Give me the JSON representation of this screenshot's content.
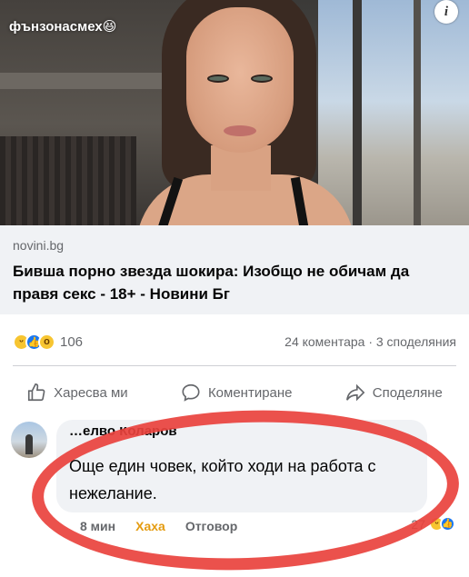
{
  "watermark": "фънзонасмех😆",
  "link_preview": {
    "domain": "novini.bg",
    "headline": "Бивша порно звезда шокира: Изобщо не обичам да правя секс - 18+ - Новини Бг"
  },
  "reactions": {
    "count": "106",
    "summary": "24 коментара · 3 споделяния",
    "types": [
      "haha",
      "like",
      "wow"
    ]
  },
  "actions": {
    "like_label": "Харесва ми",
    "comment_label": "Коментиране",
    "share_label": "Споделяне"
  },
  "comment": {
    "author": "…елво Коларов",
    "text": "Още един човек, който ходи на работа с нежелание.",
    "time": "8 мин",
    "haha_label": "Хаха",
    "reply_label": "Отговор",
    "reaction_count": "27"
  },
  "colors": {
    "fb_blue": "#1877f2",
    "haha_yellow": "#f7c531",
    "marker_red": "#e9423d",
    "muted_text": "#65676b"
  }
}
